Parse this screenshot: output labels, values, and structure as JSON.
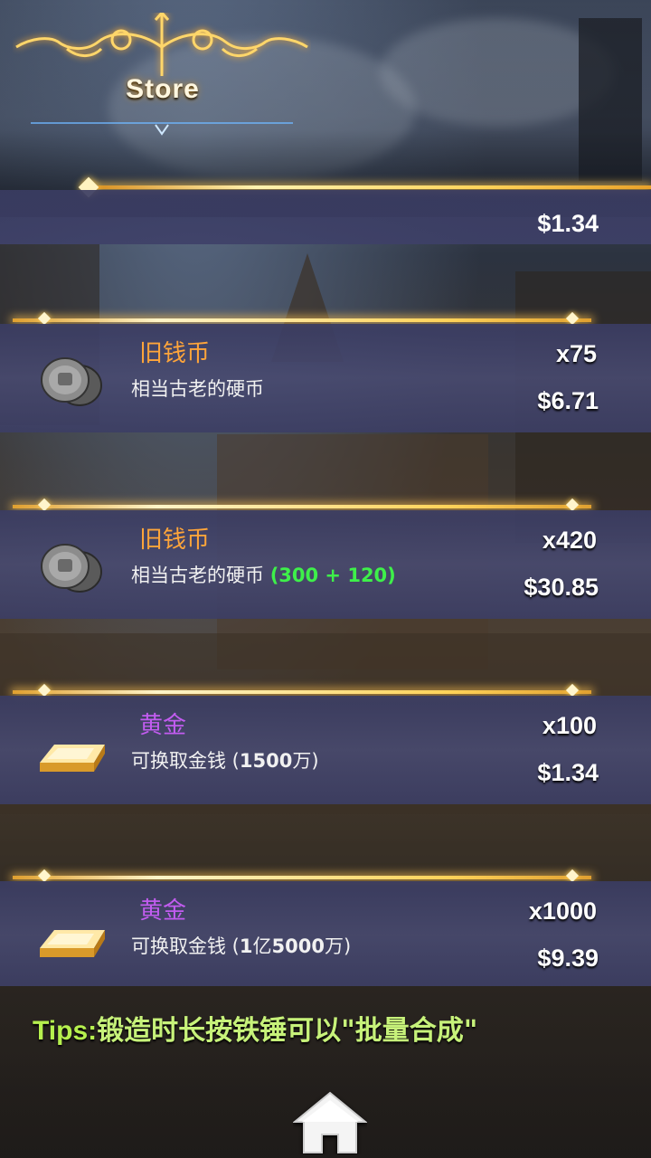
{
  "header": {
    "title": "Store"
  },
  "partial_item": {
    "price": "$1.34"
  },
  "items": [
    {
      "icon": "old-coins-icon",
      "name": "旧钱币",
      "name_color": "#ffa53a",
      "desc": "相当古老的硬币",
      "desc_extra": "",
      "qty": "x75",
      "price": "$6.71"
    },
    {
      "icon": "old-coins-icon",
      "name": "旧钱币",
      "name_color": "#ffa53a",
      "desc": "相当古老的硬币",
      "desc_extra": "(300 + 120)",
      "qty": "x420",
      "price": "$30.85"
    },
    {
      "icon": "gold-bar-icon",
      "name": "黄金",
      "name_color": "#c25cf0",
      "desc": "可换取金钱 (",
      "desc_num": "1500",
      "desc_tail": "万)",
      "qty": "x100",
      "price": "$1.34"
    },
    {
      "icon": "gold-bar-icon",
      "name": "黄金",
      "name_color": "#c25cf0",
      "desc": "可换取金钱 (",
      "desc_num": "1",
      "desc_mid": "亿",
      "desc_num2": "5000",
      "desc_tail": "万)",
      "qty": "x1000",
      "price": "$9.39"
    }
  ],
  "tips": {
    "label": "Tips:",
    "text": "锻造时长按铁锤可以\"批量合成\""
  },
  "nav": {
    "home_icon": "home-icon"
  }
}
